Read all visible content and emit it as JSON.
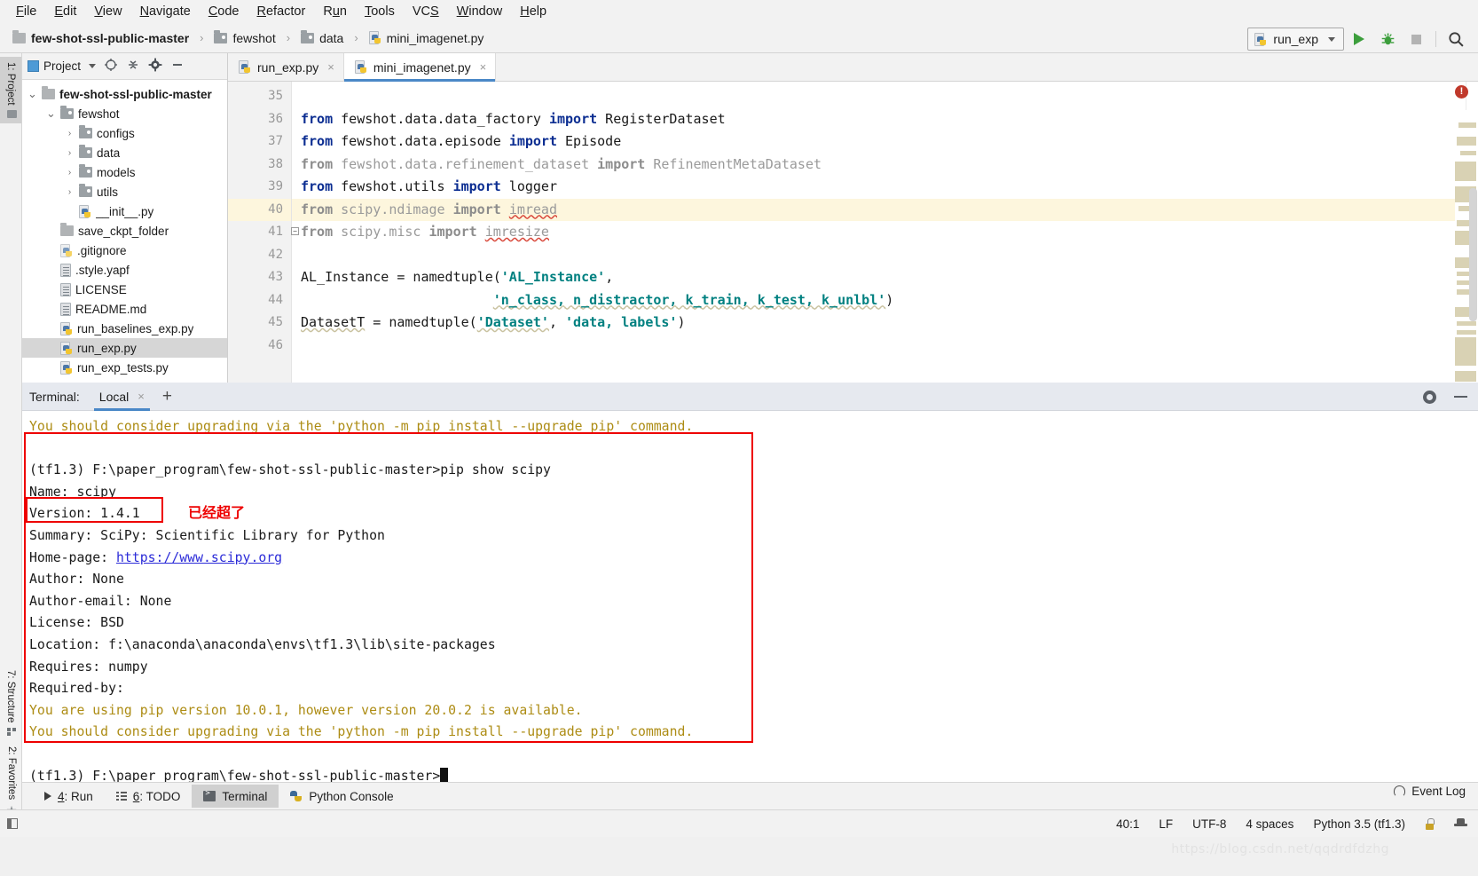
{
  "menu": {
    "items": [
      {
        "label": "File",
        "mnemonic": "F"
      },
      {
        "label": "Edit",
        "mnemonic": "E"
      },
      {
        "label": "View",
        "mnemonic": "V"
      },
      {
        "label": "Navigate",
        "mnemonic": "N"
      },
      {
        "label": "Code",
        "mnemonic": "C"
      },
      {
        "label": "Refactor",
        "mnemonic": "R"
      },
      {
        "label": "Run",
        "mnemonic": "u"
      },
      {
        "label": "Tools",
        "mnemonic": "T"
      },
      {
        "label": "VCS",
        "mnemonic": "S"
      },
      {
        "label": "Window",
        "mnemonic": "W"
      },
      {
        "label": "Help",
        "mnemonic": "H"
      }
    ]
  },
  "breadcrumb": {
    "items": [
      "few-shot-ssl-public-master",
      "fewshot",
      "data",
      "mini_imagenet.py"
    ],
    "separator": "›"
  },
  "toolbar": {
    "run_config": "run_exp",
    "run_icon": "run-triangle-icon",
    "debug_icon": "debug-bug-icon",
    "stop_icon": "stop-square-icon",
    "search_icon": "search-icon"
  },
  "left_rail": {
    "top": [
      {
        "label": "1: Project",
        "selected": true
      }
    ],
    "bottom": [
      {
        "label": "7: Structure",
        "selected": false
      },
      {
        "label": "2: Favorites",
        "selected": false
      }
    ]
  },
  "project_panel": {
    "title": "Project",
    "header_icons": [
      "target-icon",
      "collapse-all-icon",
      "gear-icon",
      "minimize-icon"
    ],
    "tree": [
      {
        "label": "few-shot-ssl-public-master",
        "indent": 0,
        "arrow": "⌄",
        "icon": "folder",
        "bold": true,
        "selected": false
      },
      {
        "label": "fewshot",
        "indent": 1,
        "arrow": "⌄",
        "icon": "folder-src",
        "bold": false,
        "selected": false
      },
      {
        "label": "configs",
        "indent": 2,
        "arrow": "›",
        "icon": "folder-src",
        "bold": false,
        "selected": false
      },
      {
        "label": "data",
        "indent": 2,
        "arrow": "›",
        "icon": "folder-src",
        "bold": false,
        "selected": false
      },
      {
        "label": "models",
        "indent": 2,
        "arrow": "›",
        "icon": "folder-src",
        "bold": false,
        "selected": false
      },
      {
        "label": "__init__.py",
        "indent": 2,
        "arrow": "",
        "icon": "python",
        "bold": false,
        "selected": false,
        "_note": "placeholder"
      },
      {
        "label": "utils",
        "indent": 2,
        "arrow": "›",
        "icon": "folder-src",
        "bold": false,
        "selected": false
      },
      {
        "label": "save_ckpt_folder",
        "indent": 1,
        "arrow": "",
        "icon": "folder",
        "bold": false,
        "selected": false
      },
      {
        "label": ".gitignore",
        "indent": 1,
        "arrow": "",
        "icon": "ignored",
        "bold": false,
        "selected": false
      },
      {
        "label": ".style.yapf",
        "indent": 1,
        "arrow": "",
        "icon": "doc",
        "bold": false,
        "selected": false
      },
      {
        "label": "LICENSE",
        "indent": 1,
        "arrow": "",
        "icon": "doc",
        "bold": false,
        "selected": false
      },
      {
        "label": "README.md",
        "indent": 1,
        "arrow": "",
        "icon": "doc",
        "bold": false,
        "selected": false
      },
      {
        "label": "run_baselines_exp.py",
        "indent": 1,
        "arrow": "",
        "icon": "python",
        "bold": false,
        "selected": false
      },
      {
        "label": "run_exp.py",
        "indent": 1,
        "arrow": "",
        "icon": "python",
        "bold": false,
        "selected": true
      },
      {
        "label": "run_exp_tests.py",
        "indent": 1,
        "arrow": "",
        "icon": "python",
        "bold": false,
        "selected": false
      }
    ]
  },
  "editor": {
    "tabs": [
      {
        "label": "run_exp.py",
        "active": false,
        "close": "×"
      },
      {
        "label": "mini_imagenet.py",
        "active": true,
        "close": "×"
      }
    ],
    "lines": [
      {
        "n": "35",
        "segs": [],
        "highlight": false
      },
      {
        "n": "36",
        "highlight": false,
        "segs": [
          {
            "t": "from",
            "c": "kw"
          },
          {
            "t": " fewshot.data.data_factory ",
            "c": "plain"
          },
          {
            "t": "import",
            "c": "kw"
          },
          {
            "t": " RegisterDataset",
            "c": "plain"
          }
        ]
      },
      {
        "n": "37",
        "highlight": false,
        "segs": [
          {
            "t": "from",
            "c": "kw"
          },
          {
            "t": " fewshot.data.episode ",
            "c": "plain"
          },
          {
            "t": "import",
            "c": "kw"
          },
          {
            "t": " Episode",
            "c": "plain"
          }
        ]
      },
      {
        "n": "38",
        "highlight": false,
        "segs": [
          {
            "t": "from",
            "c": "kw-dim"
          },
          {
            "t": " fewshot.data.refinement_dataset ",
            "c": "dim"
          },
          {
            "t": "import",
            "c": "kw-dim"
          },
          {
            "t": " RefinementMetaDataset",
            "c": "dim"
          }
        ]
      },
      {
        "n": "39",
        "highlight": false,
        "segs": [
          {
            "t": "from",
            "c": "kw"
          },
          {
            "t": " fewshot.utils ",
            "c": "plain"
          },
          {
            "t": "import",
            "c": "kw"
          },
          {
            "t": " logger",
            "c": "plain"
          }
        ]
      },
      {
        "n": "40",
        "highlight": true,
        "segs": [
          {
            "t": "from",
            "c": "kw-dim"
          },
          {
            "t": " scipy.ndimage ",
            "c": "dim"
          },
          {
            "t": "import",
            "c": "kw-dim"
          },
          {
            "t": " ",
            "c": "dim"
          },
          {
            "t": "imread",
            "c": "dim err"
          }
        ]
      },
      {
        "n": "41",
        "highlight": false,
        "fold": "−",
        "segs": [
          {
            "t": "from",
            "c": "kw-dim"
          },
          {
            "t": " scipy.misc ",
            "c": "dim"
          },
          {
            "t": "import",
            "c": "kw-dim"
          },
          {
            "t": " ",
            "c": "dim"
          },
          {
            "t": "imresize",
            "c": "dim err"
          }
        ]
      },
      {
        "n": "42",
        "segs": [],
        "highlight": false
      },
      {
        "n": "43",
        "highlight": false,
        "segs": [
          {
            "t": "AL_Instance = namedtuple(",
            "c": "plain"
          },
          {
            "t": "'AL_Instance'",
            "c": "str"
          },
          {
            "t": ",",
            "c": "plain"
          }
        ]
      },
      {
        "n": "44",
        "highlight": false,
        "segs": [
          {
            "t": "                        ",
            "c": "plain"
          },
          {
            "t": "'n_class, n_distractor, k_train, k_test, k_unlbl'",
            "c": "str warnsq"
          },
          {
            "t": ")",
            "c": "plain"
          }
        ]
      },
      {
        "n": "45",
        "highlight": false,
        "segs": [
          {
            "t": "DatasetT",
            "c": "plain warnsq"
          },
          {
            "t": " = namedtuple(",
            "c": "plain"
          },
          {
            "t": "'Dataset'",
            "c": "str warnsq"
          },
          {
            "t": ", ",
            "c": "plain"
          },
          {
            "t": "'data, labels'",
            "c": "str"
          },
          {
            "t": ")",
            "c": "plain"
          }
        ]
      },
      {
        "n": "46",
        "segs": [],
        "highlight": false
      }
    ],
    "error_badge": "!"
  },
  "terminal": {
    "label": "Terminal:",
    "tab": "Local",
    "tab_close": "×",
    "add": "+",
    "tools": [
      "gear-icon",
      "minimize-icon"
    ],
    "lines": [
      {
        "text": "You should consider upgrading via the 'python -m pip install --upgrade pip' command.",
        "kind": "warn"
      },
      {
        "text": "",
        "kind": "plain"
      },
      {
        "text": "(tf1.3) F:\\paper_program\\few-shot-ssl-public-master>pip show scipy",
        "kind": "plain"
      },
      {
        "text": "Name: scipy",
        "kind": "plain"
      },
      {
        "text": "Version: 1.4.1",
        "kind": "plain"
      },
      {
        "text": "Summary: SciPy: Scientific Library for Python",
        "kind": "plain"
      },
      {
        "text": "Home-page: ",
        "link": "https://www.scipy.org",
        "kind": "link"
      },
      {
        "text": "Author: None",
        "kind": "plain"
      },
      {
        "text": "Author-email: None",
        "kind": "plain"
      },
      {
        "text": "License: BSD",
        "kind": "plain"
      },
      {
        "text": "Location: f:\\anaconda\\anaconda\\envs\\tf1.3\\lib\\site-packages",
        "kind": "plain"
      },
      {
        "text": "Requires: numpy",
        "kind": "plain"
      },
      {
        "text": "Required-by:",
        "kind": "plain"
      },
      {
        "text": "You are using pip version 10.0.1, however version 20.0.2 is available.",
        "kind": "warn"
      },
      {
        "text": "You should consider upgrading via the 'python -m pip install --upgrade pip' command.",
        "kind": "warn"
      },
      {
        "text": "",
        "kind": "plain"
      },
      {
        "text": "(tf1.3) F:\\paper_program\\few-shot-ssl-public-master>",
        "kind": "prompt"
      }
    ]
  },
  "annotations": {
    "note_text": "已经超了",
    "color": "#ee0000"
  },
  "tool_window_bar": {
    "items": [
      {
        "label": "4: Run",
        "mnemonic": "4",
        "icon": "run-triangle-icon",
        "active": false
      },
      {
        "label": "6: TODO",
        "mnemonic": "6",
        "icon": "todo-list-icon",
        "active": false
      },
      {
        "label": "Terminal",
        "mnemonic": "",
        "icon": "terminal-icon",
        "active": true
      },
      {
        "label": "Python Console",
        "mnemonic": "",
        "icon": "python-console-icon",
        "active": false
      }
    ],
    "event_log": "Event Log"
  },
  "status_bar": {
    "caret": "40:1",
    "line_sep": "LF",
    "encoding": "UTF-8",
    "indent": "4 spaces",
    "interpreter": "Python 3.5 (tf1.3)",
    "icons": [
      "lock-icon",
      "hat-icon"
    ]
  },
  "watermark": {
    "text": "https://blog.csdn.net/qqdrdfdzhg"
  }
}
